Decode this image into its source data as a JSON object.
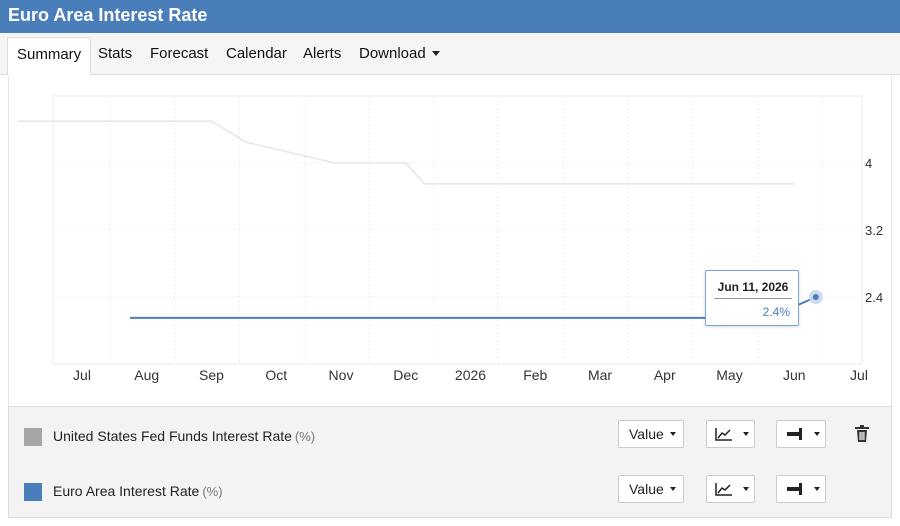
{
  "header": {
    "title": "Euro Area Interest Rate"
  },
  "tabs": [
    {
      "label": "Summary",
      "active": true
    },
    {
      "label": "Stats"
    },
    {
      "label": "Forecast"
    },
    {
      "label": "Calendar"
    },
    {
      "label": "Alerts"
    },
    {
      "label": "Download",
      "dropdown": true
    }
  ],
  "chart_data": {
    "type": "line",
    "x_ticks": [
      "Jul",
      "Aug",
      "Sep",
      "Oct",
      "Nov",
      "Dec",
      "2026",
      "Feb",
      "Mar",
      "Apr",
      "May",
      "Jun",
      "Jul"
    ],
    "y_ticks": [
      2.4,
      3.2,
      4
    ],
    "ylim": [
      1.6,
      4.8
    ],
    "grid": true,
    "y_axis_side": "right",
    "series": [
      {
        "name": "United States Fed Funds Interest Rate",
        "color": "#e6e6e6",
        "points": [
          {
            "x": "2025-06-01",
            "y": 4.5
          },
          {
            "x": "2025-09-01",
            "y": 4.5
          },
          {
            "x": "2025-09-17",
            "y": 4.25
          },
          {
            "x": "2025-10-29",
            "y": 4.0
          },
          {
            "x": "2025-12-01",
            "y": 4.0
          },
          {
            "x": "2025-12-10",
            "y": 3.75
          },
          {
            "x": "2026-06-01",
            "y": 3.75
          }
        ]
      },
      {
        "name": "Euro Area Interest Rate",
        "color": "#4a7ebb",
        "points": [
          {
            "x": "2025-07-24",
            "y": 2.15
          },
          {
            "x": "2026-05-20",
            "y": 2.15
          },
          {
            "x": "2026-06-11",
            "y": 2.4
          }
        ]
      }
    ]
  },
  "tooltip": {
    "date": "Jun 11, 2026",
    "value": "2.4%"
  },
  "legend": {
    "items": [
      {
        "name": "United States Fed Funds Interest Rate",
        "unit": "(%)",
        "color": "#a6a6a6",
        "value_label": "Value",
        "has_delete": true
      },
      {
        "name": "Euro Area Interest Rate",
        "unit": "(%)",
        "color": "#4a7ebb",
        "value_label": "Value",
        "has_delete": false
      }
    ]
  },
  "icons": {
    "chart_type": "line-chart-icon",
    "axis": "axis-side-icon",
    "delete": "trash-icon"
  }
}
